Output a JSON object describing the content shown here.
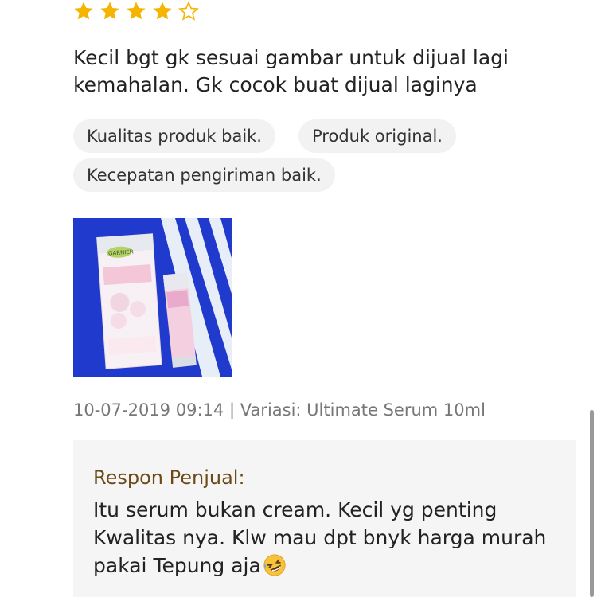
{
  "review": {
    "rating": 4,
    "rating_max": 5,
    "star_color": "#f5b400",
    "text": "Kecil bgt gk sesuai gambar untuk dijual lagi kemahalan. Gk cocok buat dijual laginya",
    "tags": [
      "Kualitas produk baik.",
      "Produk original.",
      "Kecepatan pengiriman baik."
    ],
    "photo": {
      "description_icon": "product-photo",
      "brand": "GARNIER"
    },
    "timestamp": "10-07-2019 09:14",
    "separator": "|",
    "variation": "Variasi: Ultimate Serum 10ml"
  },
  "seller_response": {
    "title": "Respon Penjual:",
    "text": "Itu serum bukan cream. Kecil yg penting Kwalitas nya. Klw mau dpt bnyk harga murah pakai Tepung aja",
    "emoji": "rolling-on-floor-laughing-emoji"
  }
}
